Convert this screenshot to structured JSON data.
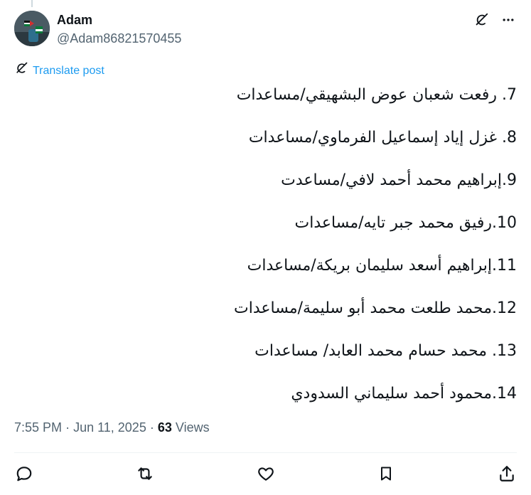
{
  "author": {
    "name": "Adam",
    "handle": "@Adam86821570455"
  },
  "translate_label": "Translate post",
  "lines": [
    "7. رفعت شعبان عوض البشهيقي/مساعدات",
    "8. غزل إياد إسماعيل الفرماوي/مساعدات",
    "9.إبراهيم محمد أحمد لافي/مساعدت",
    "10.رفيق محمد جبر تايه/مساعدات",
    "11.إبراهيم أسعد سليمان بريكة/مساعدات",
    "12.محمد طلعت محمد أبو سليمة/مساعدات",
    "13. محمد حسام محمد العابد/ مساعدات",
    "14.محمود أحمد سليماني السدودي"
  ],
  "meta": {
    "time": "7:55 PM",
    "date": "Jun 11, 2025",
    "views_count": "63",
    "views_label": "Views",
    "separator": "·"
  },
  "icons": {
    "grok": "grok-icon",
    "more": "more-icon",
    "translate": "translate-icon",
    "reply": "reply-icon",
    "repost": "repost-icon",
    "like": "like-icon",
    "bookmark": "bookmark-icon",
    "share": "share-icon"
  },
  "colors": {
    "text": "#0f1419",
    "secondary": "#536471",
    "link": "#1d9bf0",
    "divider": "#eff3f4"
  }
}
